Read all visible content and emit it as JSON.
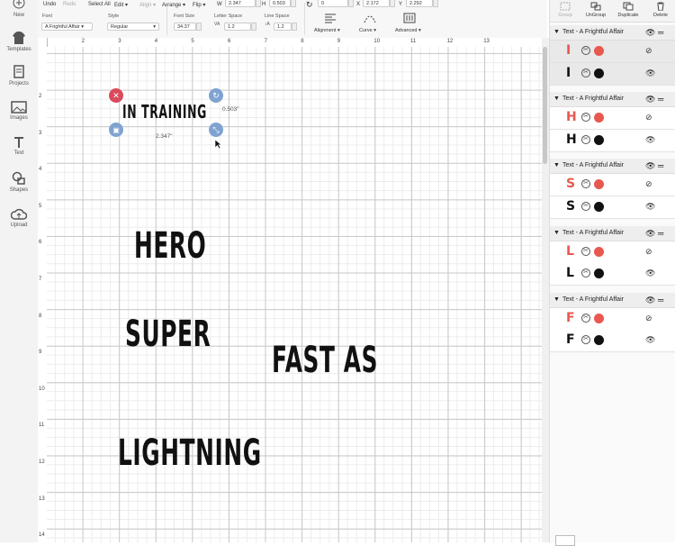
{
  "left_tools": [
    {
      "label": "New",
      "icon": "plus-icon"
    },
    {
      "label": "Templates",
      "icon": "shirt-icon"
    },
    {
      "label": "Projects",
      "icon": "projects-icon"
    },
    {
      "label": "Images",
      "icon": "image-icon"
    },
    {
      "label": "Text",
      "icon": "text-icon"
    },
    {
      "label": "Shapes",
      "icon": "shapes-icon"
    },
    {
      "label": "Upload",
      "icon": "upload-icon"
    }
  ],
  "toolbar": {
    "undo": "Undo",
    "redo": "Redo",
    "select_all": "Select All",
    "edit": "Edit ▾",
    "align": "Align ▾",
    "arrange": "Arrange ▾",
    "flip": "Flip ▾",
    "w_label": "W",
    "w_value": "2.347",
    "h_label": "H",
    "h_value": "0.503",
    "rotate_value": "0",
    "x_label": "X",
    "x_value": "2.172",
    "y_label": "Y",
    "y_value": "2.292",
    "font_label": "Font",
    "font_value": "A Frightful Affair",
    "style_label": "Style",
    "style_value": "Regular",
    "font_size_label": "Font Size",
    "font_size_value": "34.37",
    "letter_space_label": "Letter Space",
    "letter_space_value": "1.2",
    "line_space_label": "Line Space",
    "line_space_value": "1.2",
    "alignment": "Alignment ▾",
    "curve": "Curve ▾",
    "advanced": "Advanced ▾"
  },
  "ruler": {
    "top": [
      "1",
      "2",
      "3",
      "4",
      "5",
      "6",
      "7",
      "8",
      "9",
      "10",
      "11",
      "12",
      "13"
    ],
    "left": [
      "2",
      "3",
      "4",
      "5",
      "6",
      "7",
      "8",
      "9",
      "10",
      "11",
      "12",
      "13",
      "14"
    ]
  },
  "canvas": {
    "selected_text": "IN TRAINING",
    "selection": {
      "height_label": "0.503\"",
      "width_label": "2.347\""
    },
    "words": [
      "HERO",
      "SUPER",
      "FAST AS",
      "LIGHTNING"
    ]
  },
  "panel": {
    "actions": [
      {
        "label": "Group",
        "enabled": false
      },
      {
        "label": "UnGroup",
        "enabled": true
      },
      {
        "label": "Duplicate",
        "enabled": true
      },
      {
        "label": "Delete",
        "enabled": true
      }
    ],
    "groups": [
      {
        "title": "Text - A Frightful Affair",
        "letter": "I"
      },
      {
        "title": "Text - A Frightful Affair",
        "letter": "H"
      },
      {
        "title": "Text - A Frightful Affair",
        "letter": "S"
      },
      {
        "title": "Text - A Frightful Affair",
        "letter": "L"
      },
      {
        "title": "Text - A Frightful Affair",
        "letter": "F"
      }
    ],
    "accent_red": "#e8584f",
    "accent_black": "#111111"
  },
  "colors": {
    "delete_handle": "#d94a5c",
    "blue_handle": "#7fa3d1"
  }
}
